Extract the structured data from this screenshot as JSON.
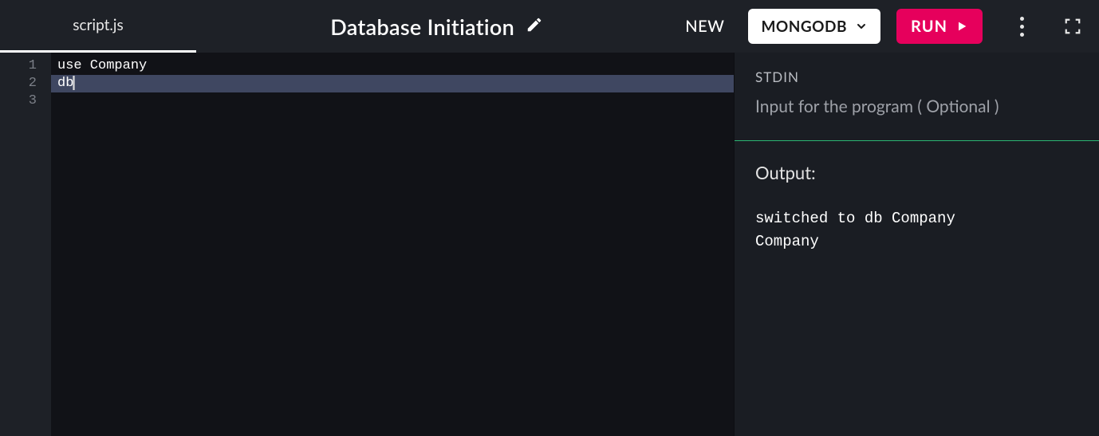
{
  "tabs": [
    {
      "label": "script.js"
    }
  ],
  "title": "Database Initiation",
  "toolbar": {
    "new_label": "NEW",
    "language": "MONGODB",
    "run_label": "RUN"
  },
  "editor": {
    "lines": [
      {
        "n": "1",
        "text": "use Company",
        "active": false
      },
      {
        "n": "2",
        "text": "db",
        "active": true
      },
      {
        "n": "3",
        "text": "",
        "active": false
      }
    ]
  },
  "stdin": {
    "label": "STDIN",
    "placeholder": "Input for the program ( Optional )"
  },
  "output": {
    "label": "Output:",
    "text": "switched to db Company\nCompany"
  }
}
